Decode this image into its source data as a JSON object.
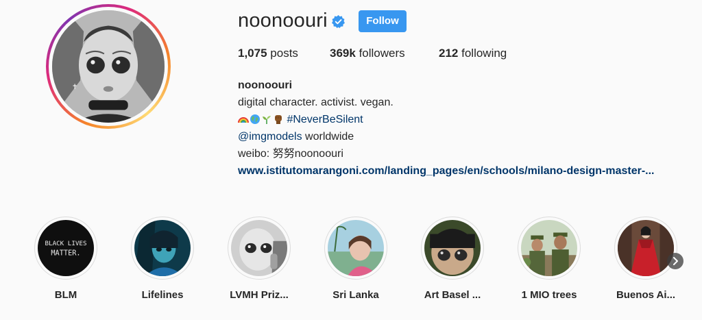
{
  "profile": {
    "username": "noonoouri",
    "verified": true,
    "follow_label": "Follow",
    "accent_color": "#3897f0"
  },
  "stats": {
    "posts_count": "1,075",
    "posts_label": "posts",
    "followers_count": "369k",
    "followers_label": "followers",
    "following_count": "212",
    "following_label": "following"
  },
  "bio": {
    "name": "noonoouri",
    "line1": "digital character. activist. vegan.",
    "emoji_names": [
      "rainbow-emoji",
      "globe-emoji",
      "seedling-emoji",
      "raised-fist-emoji"
    ],
    "hashtag": "#NeverBeSilent",
    "mention": "@imgmodels",
    "mention_suffix": " worldwide",
    "line4": "weibo: 努努noonoouri",
    "url": "www.istitutomarangoni.com/landing_pages/en/schools/milano-design-master-..."
  },
  "highlights": [
    {
      "label": "BLM",
      "cover_text": [
        "BLACK LIVES",
        "MATTER."
      ]
    },
    {
      "label": "Lifelines"
    },
    {
      "label": "LVMH Priz..."
    },
    {
      "label": "Sri Lanka"
    },
    {
      "label": "Art Basel ..."
    },
    {
      "label": "1 MIO trees"
    },
    {
      "label": "Buenos Ai..."
    }
  ],
  "icons": {
    "verified": "verified-badge-icon",
    "next": "chevron-right-icon"
  }
}
